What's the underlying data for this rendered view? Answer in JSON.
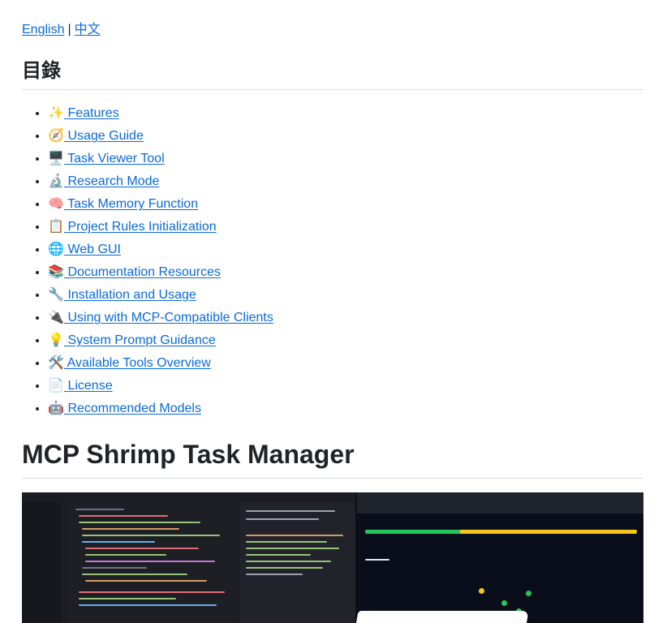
{
  "lang": {
    "english": "English",
    "separator": "|",
    "chinese": "中文"
  },
  "toc": {
    "title": "目錄",
    "items": [
      {
        "emoji": "✨",
        "label": "Features"
      },
      {
        "emoji": "🧭",
        "label": "Usage Guide"
      },
      {
        "emoji": "🖥️",
        "label": "Task Viewer Tool"
      },
      {
        "emoji": "🔬",
        "label": "Research Mode"
      },
      {
        "emoji": "🧠",
        "label": "Task Memory Function"
      },
      {
        "emoji": "📋",
        "label": "Project Rules Initialization"
      },
      {
        "emoji": "🌐",
        "label": "Web GUI"
      },
      {
        "emoji": "📚",
        "label": "Documentation Resources"
      },
      {
        "emoji": "🔧",
        "label": "Installation and Usage"
      },
      {
        "emoji": "🔌",
        "label": "Using with MCP-Compatible Clients"
      },
      {
        "emoji": "💡",
        "label": "System Prompt Guidance"
      },
      {
        "emoji": "🛠️",
        "label": "Available Tools Overview"
      },
      {
        "emoji": "📄",
        "label": "License"
      },
      {
        "emoji": "🤖",
        "label": "Recommended Models"
      }
    ]
  },
  "main": {
    "title": "MCP Shrimp Task Manager"
  },
  "colors": {
    "link": "#0969da",
    "text": "#1f2328",
    "border": "#d8dee4"
  }
}
